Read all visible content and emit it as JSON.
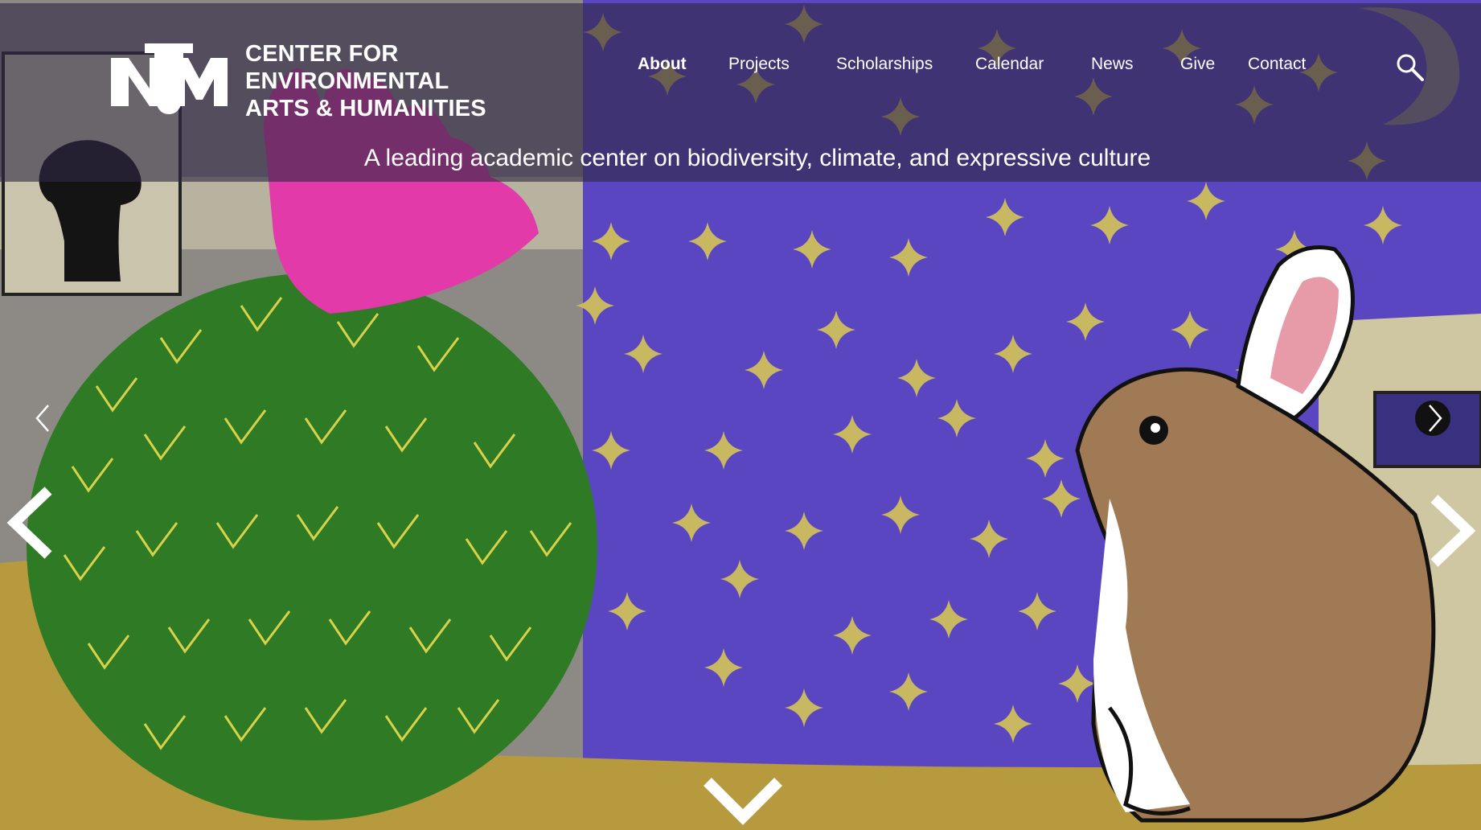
{
  "site": {
    "logo_text": "UNM",
    "name_lines": [
      "CENTER FOR",
      "ENVIRONMENTAL",
      "ARTS & HUMANITIES"
    ]
  },
  "nav": {
    "items": [
      {
        "label": "About",
        "active": true
      },
      {
        "label": "Projects",
        "active": false
      },
      {
        "label": "Scholarships",
        "active": false
      },
      {
        "label": "Calendar",
        "active": false
      },
      {
        "label": "News",
        "active": false
      },
      {
        "label": "Give",
        "active": false
      },
      {
        "label": "Contact",
        "active": false
      }
    ],
    "search_icon": "search-icon"
  },
  "hero": {
    "tagline": "A leading academic center on biodiversity, climate, and expressive culture",
    "image_subject": "illustration of a barrel cactus with a pink flower and a rabbit under a starry purple sky",
    "controls": {
      "prev_small_icon": "chevron-left-icon",
      "next_small_icon": "chevron-right-icon",
      "prev_large_icon": "chevron-left-icon",
      "next_large_icon": "chevron-right-icon",
      "scroll_down_icon": "chevron-down-icon"
    }
  },
  "colors": {
    "sky": "#5a46c0",
    "star": "#c9b862",
    "cactus": "#2f7a24",
    "flower": "#e23aa8",
    "ground": "#b89a3e",
    "wall": "#8d8a86",
    "rabbit": "#a07a54",
    "header_overlay": "#302844"
  }
}
